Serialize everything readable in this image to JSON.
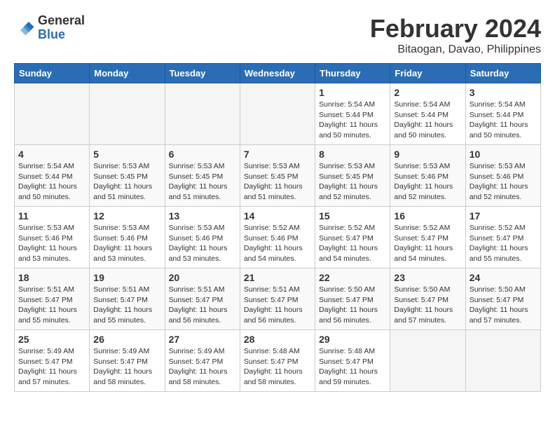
{
  "header": {
    "logo_general": "General",
    "logo_blue": "Blue",
    "title": "February 2024",
    "subtitle": "Bitaogan, Davao, Philippines"
  },
  "weekdays": [
    "Sunday",
    "Monday",
    "Tuesday",
    "Wednesday",
    "Thursday",
    "Friday",
    "Saturday"
  ],
  "weeks": [
    [
      {
        "day": "",
        "info": ""
      },
      {
        "day": "",
        "info": ""
      },
      {
        "day": "",
        "info": ""
      },
      {
        "day": "",
        "info": ""
      },
      {
        "day": "1",
        "info": "Sunrise: 5:54 AM\nSunset: 5:44 PM\nDaylight: 11 hours\nand 50 minutes."
      },
      {
        "day": "2",
        "info": "Sunrise: 5:54 AM\nSunset: 5:44 PM\nDaylight: 11 hours\nand 50 minutes."
      },
      {
        "day": "3",
        "info": "Sunrise: 5:54 AM\nSunset: 5:44 PM\nDaylight: 11 hours\nand 50 minutes."
      }
    ],
    [
      {
        "day": "4",
        "info": "Sunrise: 5:54 AM\nSunset: 5:44 PM\nDaylight: 11 hours\nand 50 minutes."
      },
      {
        "day": "5",
        "info": "Sunrise: 5:53 AM\nSunset: 5:45 PM\nDaylight: 11 hours\nand 51 minutes."
      },
      {
        "day": "6",
        "info": "Sunrise: 5:53 AM\nSunset: 5:45 PM\nDaylight: 11 hours\nand 51 minutes."
      },
      {
        "day": "7",
        "info": "Sunrise: 5:53 AM\nSunset: 5:45 PM\nDaylight: 11 hours\nand 51 minutes."
      },
      {
        "day": "8",
        "info": "Sunrise: 5:53 AM\nSunset: 5:45 PM\nDaylight: 11 hours\nand 52 minutes."
      },
      {
        "day": "9",
        "info": "Sunrise: 5:53 AM\nSunset: 5:46 PM\nDaylight: 11 hours\nand 52 minutes."
      },
      {
        "day": "10",
        "info": "Sunrise: 5:53 AM\nSunset: 5:46 PM\nDaylight: 11 hours\nand 52 minutes."
      }
    ],
    [
      {
        "day": "11",
        "info": "Sunrise: 5:53 AM\nSunset: 5:46 PM\nDaylight: 11 hours\nand 53 minutes."
      },
      {
        "day": "12",
        "info": "Sunrise: 5:53 AM\nSunset: 5:46 PM\nDaylight: 11 hours\nand 53 minutes."
      },
      {
        "day": "13",
        "info": "Sunrise: 5:53 AM\nSunset: 5:46 PM\nDaylight: 11 hours\nand 53 minutes."
      },
      {
        "day": "14",
        "info": "Sunrise: 5:52 AM\nSunset: 5:46 PM\nDaylight: 11 hours\nand 54 minutes."
      },
      {
        "day": "15",
        "info": "Sunrise: 5:52 AM\nSunset: 5:47 PM\nDaylight: 11 hours\nand 54 minutes."
      },
      {
        "day": "16",
        "info": "Sunrise: 5:52 AM\nSunset: 5:47 PM\nDaylight: 11 hours\nand 54 minutes."
      },
      {
        "day": "17",
        "info": "Sunrise: 5:52 AM\nSunset: 5:47 PM\nDaylight: 11 hours\nand 55 minutes."
      }
    ],
    [
      {
        "day": "18",
        "info": "Sunrise: 5:51 AM\nSunset: 5:47 PM\nDaylight: 11 hours\nand 55 minutes."
      },
      {
        "day": "19",
        "info": "Sunrise: 5:51 AM\nSunset: 5:47 PM\nDaylight: 11 hours\nand 55 minutes."
      },
      {
        "day": "20",
        "info": "Sunrise: 5:51 AM\nSunset: 5:47 PM\nDaylight: 11 hours\nand 56 minutes."
      },
      {
        "day": "21",
        "info": "Sunrise: 5:51 AM\nSunset: 5:47 PM\nDaylight: 11 hours\nand 56 minutes."
      },
      {
        "day": "22",
        "info": "Sunrise: 5:50 AM\nSunset: 5:47 PM\nDaylight: 11 hours\nand 56 minutes."
      },
      {
        "day": "23",
        "info": "Sunrise: 5:50 AM\nSunset: 5:47 PM\nDaylight: 11 hours\nand 57 minutes."
      },
      {
        "day": "24",
        "info": "Sunrise: 5:50 AM\nSunset: 5:47 PM\nDaylight: 11 hours\nand 57 minutes."
      }
    ],
    [
      {
        "day": "25",
        "info": "Sunrise: 5:49 AM\nSunset: 5:47 PM\nDaylight: 11 hours\nand 57 minutes."
      },
      {
        "day": "26",
        "info": "Sunrise: 5:49 AM\nSunset: 5:47 PM\nDaylight: 11 hours\nand 58 minutes."
      },
      {
        "day": "27",
        "info": "Sunrise: 5:49 AM\nSunset: 5:47 PM\nDaylight: 11 hours\nand 58 minutes."
      },
      {
        "day": "28",
        "info": "Sunrise: 5:48 AM\nSunset: 5:47 PM\nDaylight: 11 hours\nand 58 minutes."
      },
      {
        "day": "29",
        "info": "Sunrise: 5:48 AM\nSunset: 5:47 PM\nDaylight: 11 hours\nand 59 minutes."
      },
      {
        "day": "",
        "info": ""
      },
      {
        "day": "",
        "info": ""
      }
    ]
  ]
}
